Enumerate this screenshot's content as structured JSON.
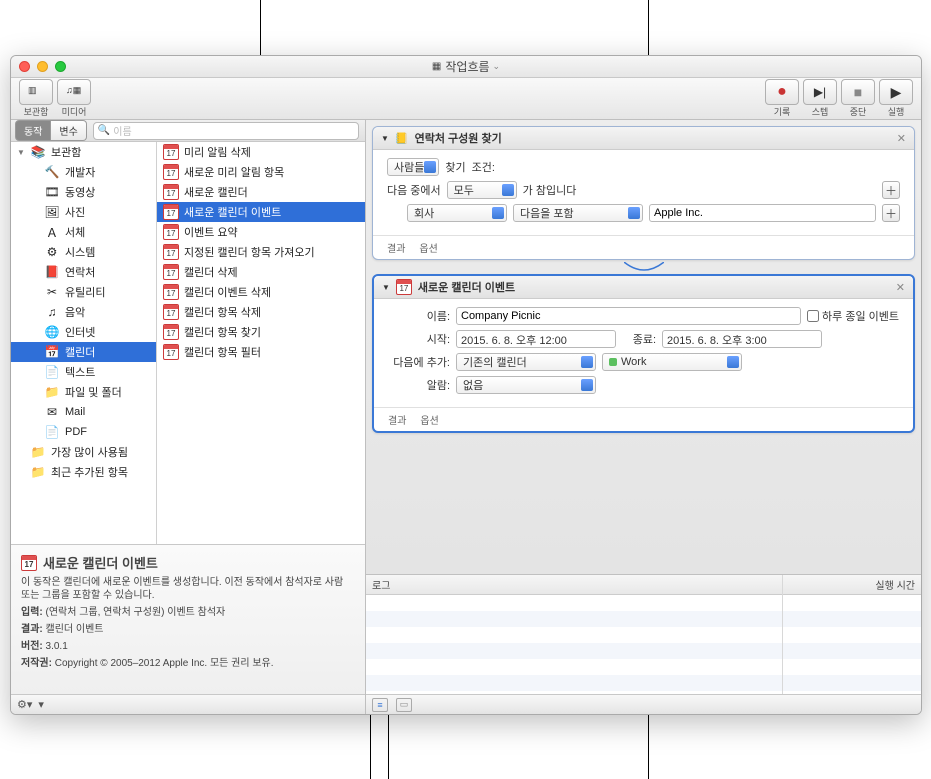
{
  "title": "작업흐름",
  "toolbar": {
    "left": [
      {
        "name": "library",
        "label": "보관함"
      },
      {
        "name": "media",
        "label": "미디어"
      }
    ],
    "right": [
      {
        "name": "record",
        "label": "기록",
        "color": "#c93434"
      },
      {
        "name": "step",
        "label": "스텝"
      },
      {
        "name": "stop",
        "label": "중단"
      },
      {
        "name": "run",
        "label": "실행"
      }
    ]
  },
  "segments": {
    "action": "동작",
    "variable": "변수"
  },
  "search_placeholder": "이름",
  "sidebar": [
    {
      "label": "보관함",
      "icon": "library",
      "indent": 0,
      "tri": "▼"
    },
    {
      "label": "개발자",
      "icon": "hammer",
      "indent": 1
    },
    {
      "label": "동영상",
      "icon": "film",
      "indent": 1
    },
    {
      "label": "사진",
      "icon": "photo",
      "indent": 1
    },
    {
      "label": "서체",
      "icon": "font",
      "indent": 1
    },
    {
      "label": "시스템",
      "icon": "gear",
      "indent": 1
    },
    {
      "label": "연락처",
      "icon": "book",
      "indent": 1
    },
    {
      "label": "유틸리티",
      "icon": "util",
      "indent": 1
    },
    {
      "label": "음악",
      "icon": "music",
      "indent": 1
    },
    {
      "label": "인터넷",
      "icon": "globe",
      "indent": 1
    },
    {
      "label": "캘린더",
      "icon": "calendar",
      "indent": 1,
      "sel": true
    },
    {
      "label": "텍스트",
      "icon": "text",
      "indent": 1
    },
    {
      "label": "파일 및 폴더",
      "icon": "folder",
      "indent": 1
    },
    {
      "label": "Mail",
      "icon": "mail",
      "indent": 1
    },
    {
      "label": "PDF",
      "icon": "pdf",
      "indent": 1
    },
    {
      "label": "가장 많이 사용됨",
      "icon": "purple",
      "indent": 0
    },
    {
      "label": "최근 추가된 항목",
      "icon": "purple",
      "indent": 0
    }
  ],
  "actions": [
    {
      "label": "미리 알림 삭제"
    },
    {
      "label": "새로운 미리 알림 항목"
    },
    {
      "label": "새로운 캘린더"
    },
    {
      "label": "새로운 캘린더 이벤트",
      "sel": true
    },
    {
      "label": "이벤트 요약"
    },
    {
      "label": "지정된 캘린더 항목 가져오기"
    },
    {
      "label": "캘린더 삭제"
    },
    {
      "label": "캘린더 이벤트 삭제"
    },
    {
      "label": "캘린더 항목 삭제"
    },
    {
      "label": "캘린더 항목 찾기"
    },
    {
      "label": "캘린더 항목 필터"
    }
  ],
  "info": {
    "title": "새로운 캘린더 이벤트",
    "desc": "이 동작은 캘린더에 새로운 이벤트를 생성합니다. 이전 동작에서 참석자로 사람 또는 그룹을 포함할 수 있습니다.",
    "input_label": "입력:",
    "input_val": "(연락처 그룹, 연락처 구성원) 이벤트 참석자",
    "result_label": "결과:",
    "result_val": "캘린더 이벤트",
    "version_label": "버전:",
    "version_val": "3.0.1",
    "copyright_label": "저작권:",
    "copyright_val": "Copyright © 2005–2012 Apple Inc.  모든 권리 보유."
  },
  "card1": {
    "title": "연락처 구성원 찾기",
    "people": "사람들",
    "find": "찾기",
    "cond": "조건:",
    "allof_pre": "다음 중에서",
    "allof": "모두",
    "allof_post": "가 참입니다",
    "field": "회사",
    "op": "다음을 포함",
    "val": "Apple Inc.",
    "result": "결과",
    "options": "옵션"
  },
  "card2": {
    "title": "새로운 캘린더 이벤트",
    "name_label": "이름:",
    "name_val": "Company Picnic",
    "allday": "하루 종일 이벤트",
    "start_label": "시작:",
    "start_val": "2015.  6.  8. 오후 12:00",
    "end_label": "종료:",
    "end_val": "2015.  6.  8. 오후  3:00",
    "addto_label": "다음에 추가:",
    "addto_val": "기존의 캘린더",
    "cal_val": "Work",
    "alarm_label": "알람:",
    "alarm_val": "없음",
    "result": "결과",
    "options": "옵션"
  },
  "log": {
    "log": "로그",
    "runtime": "실행 시간"
  }
}
